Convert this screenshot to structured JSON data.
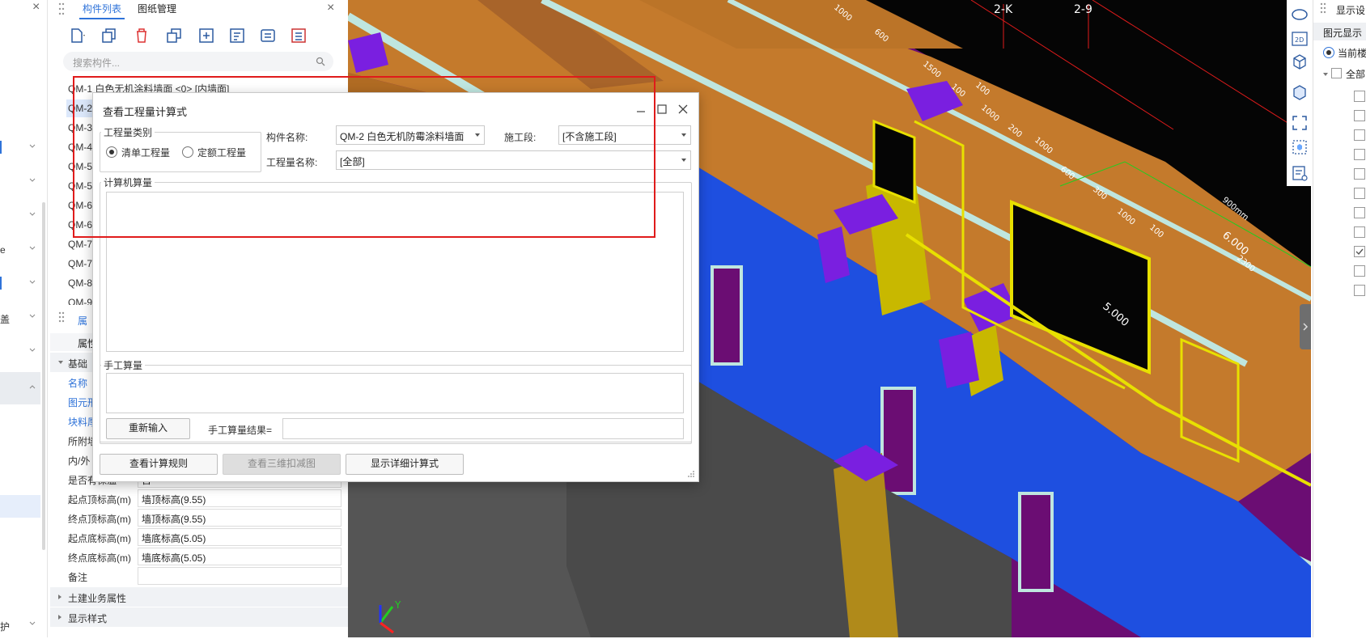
{
  "left_strip": {
    "close_glyph": "×",
    "items": [
      {
        "label": "",
        "active": true
      },
      {
        "label": ""
      },
      {
        "label": ""
      },
      {
        "label": "e"
      },
      {
        "label": ""
      },
      {
        "label": "盖"
      },
      {
        "label": ""
      },
      {
        "label": ""
      },
      {
        "label": "护"
      }
    ]
  },
  "component_panel": {
    "tabs": [
      "构件列表",
      "图纸管理"
    ],
    "close_glyph": "×",
    "search_placeholder": "搜索构件...",
    "items": [
      "QM-1  白色无机涂料墙面 <0> [内墙面]",
      "QM-2",
      "QM-3",
      "QM-4",
      "QM-5",
      "QM-5",
      "QM-6",
      "QM-6",
      "QM-7",
      "QM-7",
      "QM-8",
      "QM-9"
    ]
  },
  "property_panel": {
    "tab": "属",
    "header": "属性",
    "group_basic": "基础",
    "rows_partial": [
      "名称",
      "图元形",
      "块料厚",
      "所附墙",
      "内/外"
    ],
    "rows": [
      {
        "key": "是否有保温",
        "value": "否"
      },
      {
        "key": "起点顶标高(m)",
        "value": "墙顶标高(9.55)"
      },
      {
        "key": "终点顶标高(m)",
        "value": "墙顶标高(9.55)"
      },
      {
        "key": "起点底标高(m)",
        "value": "墙底标高(5.05)"
      },
      {
        "key": "终点底标高(m)",
        "value": "墙底标高(5.05)"
      },
      {
        "key": "备注",
        "value": ""
      }
    ],
    "group_civil": "土建业务属性",
    "group_display": "显示样式"
  },
  "viewport": {
    "axis_labels": [
      "2-K",
      "2-9"
    ],
    "dims": [
      "1000",
      "600",
      "1500",
      "100",
      "100",
      "1000",
      "200",
      "1000",
      "600",
      "300",
      "1000",
      "100",
      "6.000",
      "5.000",
      "2300",
      "900mm"
    ],
    "axes": {
      "y": "Y"
    }
  },
  "right_panel": {
    "title": "显示设",
    "subtitle": "图元显示",
    "radio": "当前楼",
    "all": "全部"
  },
  "dialog": {
    "title": "查看工程量计算式",
    "qty_type_label": "工程量类别",
    "radio_list": "清单工程量",
    "radio_quota": "定额工程量",
    "component_label": "构件名称:",
    "component_value": "QM-2  白色无机防霉涂料墙面",
    "stage_label": "施工段:",
    "stage_value": "[不含施工段]",
    "qty_name_label": "工程量名称:",
    "qty_name_value": "[全部]",
    "computer_calc_label": "计算机算量",
    "manual_calc_label": "手工算量",
    "reinput_btn": "重新输入",
    "manual_result_label": "手工算量结果=",
    "btn_rules": "查看计算规则",
    "btn_3d": "查看三维扣减图",
    "btn_detail": "显示详细计算式"
  },
  "colors": {
    "accent": "#2f73d9",
    "annotation_red": "#e01b1b",
    "wall_orange": "#c47a2c",
    "wall_blue": "#1e4fe0",
    "column_purple": "#7a1fe0",
    "yellow": "#d8c800"
  }
}
